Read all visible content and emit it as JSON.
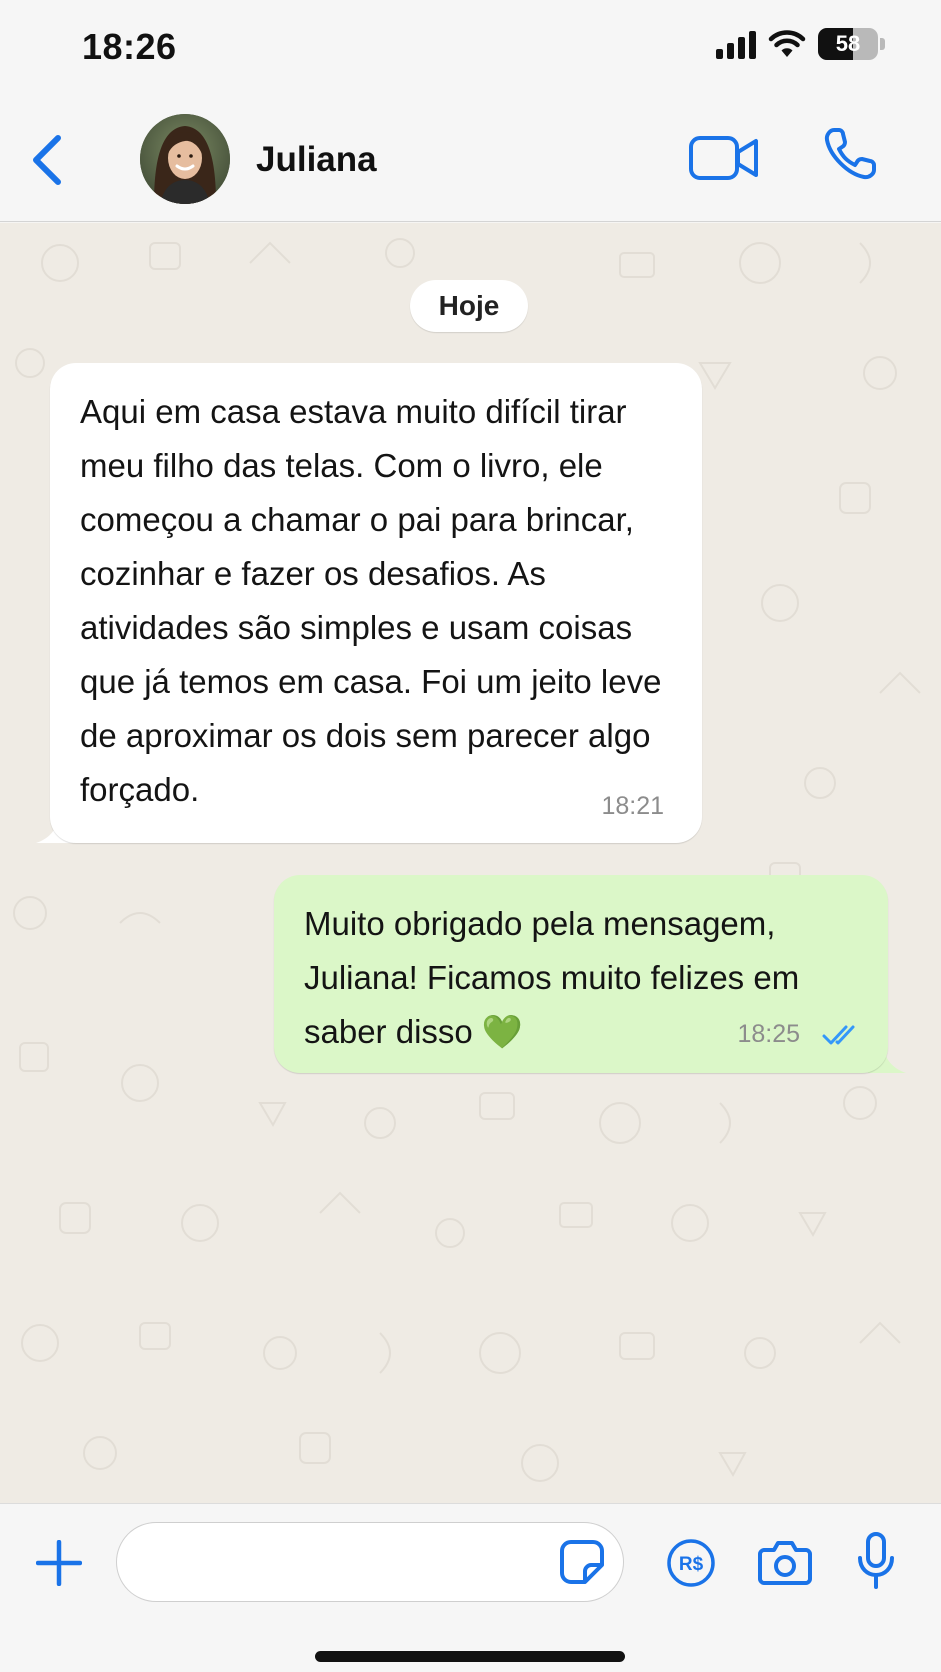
{
  "status_bar": {
    "time": "18:26",
    "battery_level": "58",
    "icons": [
      "signal-icon",
      "wifi-icon",
      "battery-icon"
    ]
  },
  "header": {
    "contact_name": "Juliana",
    "icons": [
      "back-chevron-icon",
      "avatar-photo",
      "video-call-icon",
      "phone-call-icon"
    ]
  },
  "chat": {
    "date_label": "Hoje",
    "messages": [
      {
        "direction": "incoming",
        "text": "Aqui em casa estava muito difícil tirar meu filho das telas. Com o livro, ele começou a chamar o pai para brincar, cozinhar e fazer os desafios. As atividades são simples e usam coisas que já temos em casa. Foi um jeito leve de aproximar os dois sem parecer algo forçado.",
        "time": "18:21"
      },
      {
        "direction": "outgoing",
        "text": "Muito obrigado pela mensagem, Juliana! Ficamos muito felizes em saber disso 💚",
        "time": "18:25",
        "status": "read"
      }
    ]
  },
  "composer": {
    "input_value": "",
    "icons": [
      "plus-icon",
      "sticker-icon",
      "pix-payment-icon",
      "camera-icon",
      "microphone-icon"
    ]
  },
  "colors": {
    "accent": "#1a73e8",
    "incoming_bubble": "#ffffff",
    "outgoing_bubble": "#dbf7c8",
    "chat_background": "#efebe4",
    "read_ticks": "#3497f9"
  }
}
